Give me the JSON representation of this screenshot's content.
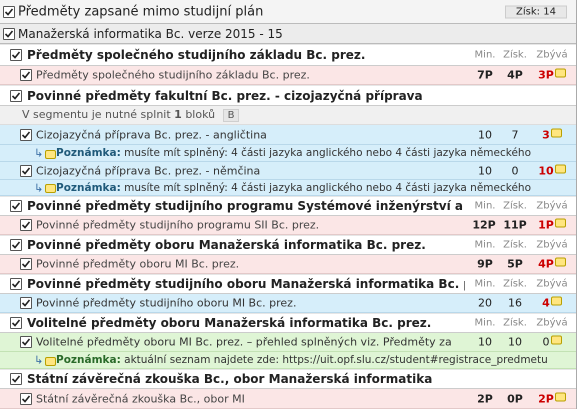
{
  "outer": {
    "title": "Předměty zapsané mimo studijní plán",
    "zisk": "Získ: 14"
  },
  "plan": {
    "title": "Manažerská informatika Bc. verze 2015 - 15"
  },
  "headers": {
    "min": "Min.",
    "zisk": "Získ.",
    "zbyva": "Zbývá"
  },
  "sections": [
    {
      "title": "Předměty společného studijního základu Bc. prez."
    },
    {
      "title": "Povinné předměty fakultní Bc. prez. - cizojazyčná příprava",
      "segment_text": "V segmentu je nutné splnit",
      "segment_count": "1",
      "segment_unit": "bloků",
      "segment_pill": "B"
    },
    {
      "title": "Povinné předměty studijního programu Systémové inženýrství a in"
    },
    {
      "title": "Povinné předměty oboru Manažerská informatika Bc. prez."
    },
    {
      "title": "Povinné předměty studijního oboru Manažerská informatika Bc. prez."
    },
    {
      "title": "Volitelné předměty oboru Manažerská informatika Bc. prez."
    },
    {
      "title": "Státní závěrečná zkouška Bc., obor Manažerská informatika"
    }
  ],
  "blocks": [
    {
      "label": "Předměty společného studijního základu Bc. prez.",
      "min": "7P",
      "zisk": "4P",
      "zbyva": "3P"
    },
    {
      "label": "Cizojazyčná příprava Bc. prez. - angličtina",
      "min": "10",
      "zisk": "7",
      "zbyva": "3"
    },
    {
      "label": "Cizojazyčná příprava Bc. prez. - němčina",
      "min": "10",
      "zisk": "0",
      "zbyva": "10"
    },
    {
      "label": "Povinné předměty studijního programu SII Bc. prez.",
      "min": "12P",
      "zisk": "11P",
      "zbyva": "1P"
    },
    {
      "label": "Povinné předměty oboru MI Bc. prez.",
      "min": "9P",
      "zisk": "5P",
      "zbyva": "4P"
    },
    {
      "label": "Povinné předměty studijního oboru MI Bc. prez.",
      "min": "20",
      "zisk": "16",
      "zbyva": "4"
    },
    {
      "label": "Volitelné předměty oboru MI Bc. prez. – přehled splněných viz. Předměty za",
      "min": "10",
      "zisk": "10",
      "zbyva": "0"
    },
    {
      "label": "Státní závěrečná zkouška Bc., obor MI",
      "min": "2P",
      "zisk": "0P",
      "zbyva": "2P"
    }
  ],
  "notes": [
    {
      "label": "Poznámka:",
      "text": "musíte mít splněný: 4 části jazyka anglického nebo 4 části jazyka německého"
    },
    {
      "label": "Poznámka:",
      "text": "musíte mít splněný: 4 části jazyka anglického nebo 4 části jazyka německého"
    },
    {
      "label": "Poznámka:",
      "text": "aktuální seznam najdete zde: https://uit.opf.slu.cz/student#registrace_predmetu"
    }
  ],
  "colors": {
    "pink": "#fbe6e6",
    "blue": "#d6eefa",
    "green": "#dff5d5",
    "header": "#ffffff",
    "red": "#cc0000"
  },
  "icons": {
    "check": "check-icon",
    "note": "note-icon",
    "arrow": "arrow-note-icon"
  }
}
